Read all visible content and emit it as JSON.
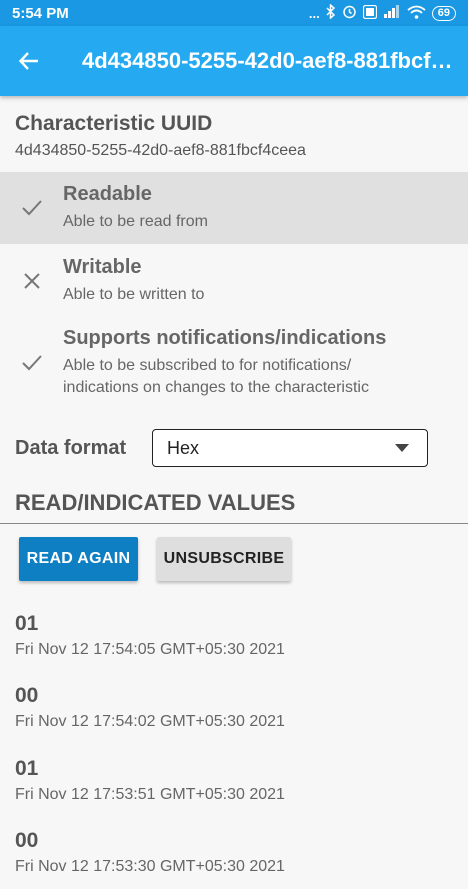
{
  "status_bar": {
    "time": "5:54 PM",
    "dots": "...",
    "battery": "69"
  },
  "app_bar": {
    "title": "4d434850-5255-42d0-aef8-881fbcf4ceea"
  },
  "characteristic": {
    "label": "Characteristic UUID",
    "uuid": "4d434850-5255-42d0-aef8-881fbcf4ceea"
  },
  "properties": [
    {
      "title": "Readable",
      "subtitle": "Able to be read from",
      "icon": "check-icon",
      "enabled": true,
      "highlighted": true
    },
    {
      "title": "Writable",
      "subtitle": "Able to be written to",
      "icon": "close-icon",
      "enabled": false,
      "highlighted": false
    },
    {
      "title": "Supports notifications/indications",
      "subtitle": "Able to be subscribed to for notifications/ indications on changes to the characteristic",
      "icon": "check-icon",
      "enabled": true,
      "highlighted": false
    }
  ],
  "data_format": {
    "label": "Data format",
    "selected": "Hex"
  },
  "values_section": {
    "title": "READ/INDICATED VALUES",
    "read_again": "READ AGAIN",
    "unsubscribe": "UNSUBSCRIBE"
  },
  "values": [
    {
      "value": "01",
      "time": "Fri Nov 12 17:54:05 GMT+05:30 2021"
    },
    {
      "value": "00",
      "time": "Fri Nov 12 17:54:02 GMT+05:30 2021"
    },
    {
      "value": "01",
      "time": "Fri Nov 12 17:53:51 GMT+05:30 2021"
    },
    {
      "value": "00",
      "time": "Fri Nov 12 17:53:30 GMT+05:30 2021"
    }
  ],
  "colors": {
    "status_bar": "#1a98e3",
    "app_bar": "#25a9f0",
    "primary_button": "#0e7fc3",
    "secondary_button": "#dedede",
    "highlight_row": "#e0e0e0"
  }
}
